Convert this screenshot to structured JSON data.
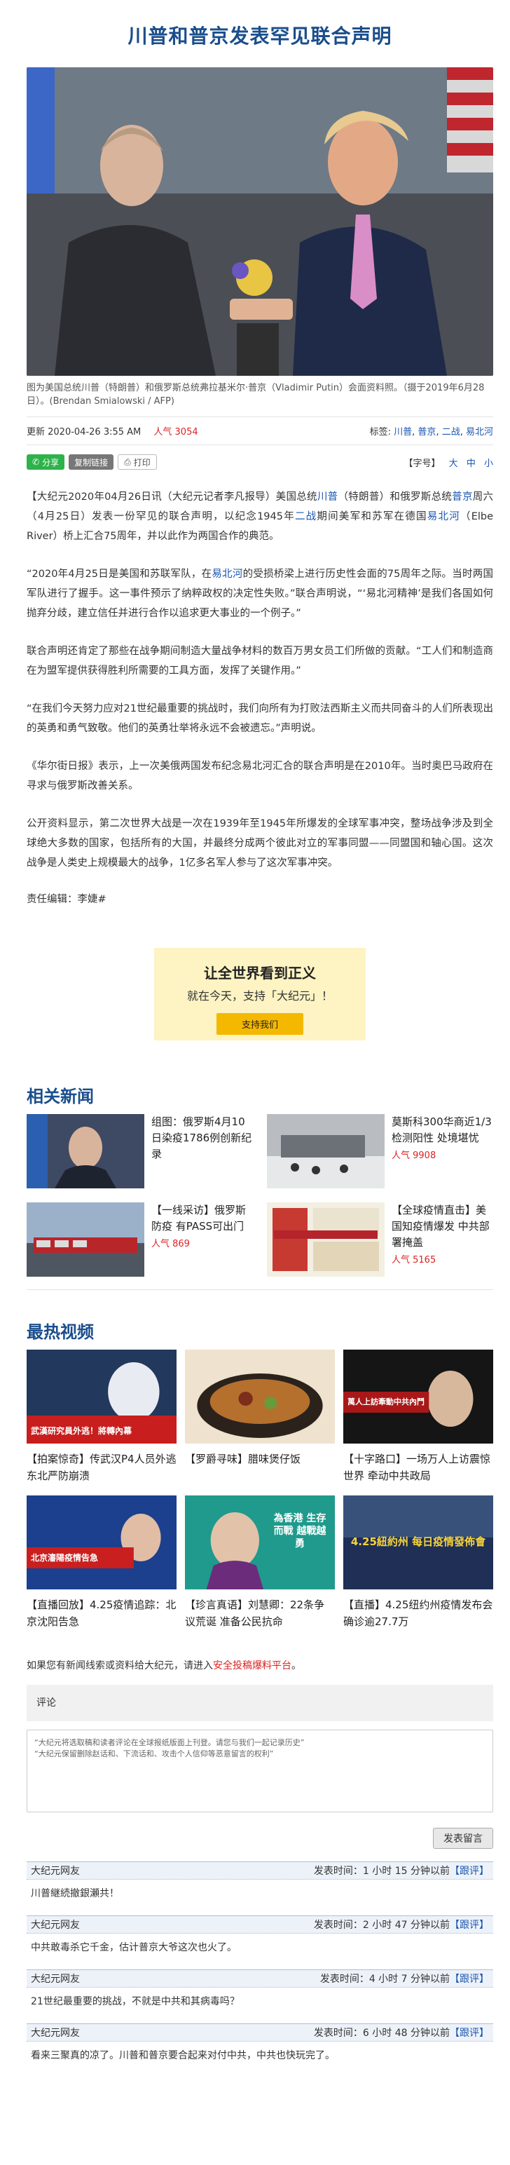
{
  "headline": "川普和普京发表罕见联合声明",
  "caption": "图为美国总统川普（特朗普）和俄罗斯总统弗拉基米尔·普京（Vladimir Putin）会面资料照。（摄于2019年6月28日）。(Brendan Smialowski / AFP)",
  "meta": {
    "updated": "更新 2020-04-26 3:55 AM",
    "popularity": "人气 3054",
    "tags_label": "标签:",
    "tags": [
      "川普",
      "普京",
      "二战",
      "易北河"
    ]
  },
  "toolbar": {
    "share": "分享",
    "copy": "复制链接",
    "print": "打印",
    "font_label": "【字号】",
    "font_sizes": [
      "大",
      "中",
      "小"
    ]
  },
  "body": {
    "p1a": "【大纪元2020年04月26日讯（大纪元记者李凡报导）美国总统",
    "p1l1": "川普",
    "p1b": "（特朗普）和俄罗斯总统",
    "p1l2": "普京",
    "p1c": "周六（4月25日）发表一份罕见的联合声明，以纪念1945年",
    "p1l3": "二战",
    "p1d": "期间美军和苏军在德国",
    "p1l4": "易北河",
    "p1e": "（Elbe River）桥上汇合75周年，并以此作为两国合作的典范。",
    "p2a": "“2020年4月25日是美国和苏联军队，在",
    "p2l1": "易北河",
    "p2b": "的受损桥梁上进行历史性会面的75周年之际。当时两国军队进行了握手。这一事件预示了纳粹政权的决定性失败。”联合声明说，“‘易北河精神’是我们各国如何抛弃分歧，建立信任并进行合作以追求更大事业的一个例子。”",
    "p3": "联合声明还肯定了那些在战争期间制造大量战争材料的数百万男女员工们所做的贡献。“工人们和制造商在为盟军提供获得胜利所需要的工具方面，发挥了关键作用。”",
    "p4": "“在我们今天努力应对21世纪最重要的挑战时，我们向所有为打败法西斯主义而共同奋斗的人们所表现出的英勇和勇气致敬。他们的英勇壮举将永远不会被遗忘。”声明说。",
    "p5": "《华尔街日报》表示，上一次美俄两国发布纪念易北河汇合的联合声明是在2010年。当时奥巴马政府在寻求与俄罗斯改善关系。",
    "p6": "公开资料显示，第二次世界大战是一次在1939年至1945年所爆发的全球军事冲突，整场战争涉及到全球绝大多数的国家，包括所有的大国，并最终分成两个彼此对立的军事同盟——同盟国和轴心国。这次战争是人类史上规模最大的战争，1亿多名军人参与了这次军事冲突。",
    "editor": "责任编辑：李婕#"
  },
  "donate": {
    "line1": "让全世界看到正义",
    "line2": "就在今天，支持「大纪元」！",
    "button": "支持我们"
  },
  "related": {
    "title": "相关新闻",
    "items": [
      {
        "title": "组图：俄罗斯4月10日染疫1786例创新纪录",
        "pop": ""
      },
      {
        "title": "莫斯科300华商近1/3检测阳性 处境堪忧",
        "pop": "人气 9908"
      },
      {
        "title": "【一线采访】俄罗斯防疫 有PASS可出门",
        "pop": "人气 869"
      },
      {
        "title": "【全球疫情直击】美国知疫情爆发 中共部署掩盖",
        "pop": "人气 5165"
      }
    ]
  },
  "videos": {
    "title": "最热视频",
    "items": [
      {
        "title": "【拍案惊奇】传武汉P4人员外逃 东北严防崩溃",
        "overlay": "武漢研究員外逃！將轉內幕"
      },
      {
        "title": "【罗爵寻味】腊味煲仔饭",
        "overlay": ""
      },
      {
        "title": "【十字路口】一场万人上访震惊世界 牵动中共政局",
        "overlay": "萬人上訪牽動中共內鬥"
      },
      {
        "title": "【直播回放】4.25疫情追踪：北京沈阳告急",
        "overlay": "北京瀋陽疫情告急"
      },
      {
        "title": "【珍言真语】刘慧卿：22条争议荒诞 准备公民抗命",
        "overlay": "為香港 生存而戰 越戰越勇"
      },
      {
        "title": "【直播】4.25纽约州疫情发布会 确诊逾27.7万",
        "overlay": "4.25紐約州 每日疫情發佈會"
      }
    ]
  },
  "tip": {
    "prefix": "如果您有新闻线索或资料给大纪元，请进入",
    "link": "安全投稿爆料平台",
    "suffix": "。"
  },
  "comments": {
    "header": "评论",
    "placeholder_l1": "“大纪元将选取稿和读者评论在全球报纸版面上刊登。请您与我们一起记录历史”",
    "placeholder_l2": "“大纪元保留删除赵话和、下流话和、攻击个人信仰等恶意留言的权利”",
    "submit": "发表留言",
    "list": [
      {
        "user": "大纪元网友",
        "time": "发表时间：1 小时 15 分钟以前",
        "reply": "【跟评】",
        "text": "川普継続撤銀瀬共！"
      },
      {
        "user": "大纪元网友",
        "time": "发表时间：2 小时 47 分钟以前",
        "reply": "【跟评】",
        "text": "中共敢毒杀它千金，估计普京大爷这次也火了。"
      },
      {
        "user": "大纪元网友",
        "time": "发表时间：4 小时 7 分钟以前",
        "reply": "【跟评】",
        "text": "21世纪最重要的挑战，不就是中共和其病毒吗？"
      },
      {
        "user": "大纪元网友",
        "time": "发表时间：6 小时 48 分钟以前",
        "reply": "【跟评】",
        "text": "看来三聚真的凉了。川普和普京要合起来对付中共，中共也快玩完了。"
      }
    ]
  }
}
